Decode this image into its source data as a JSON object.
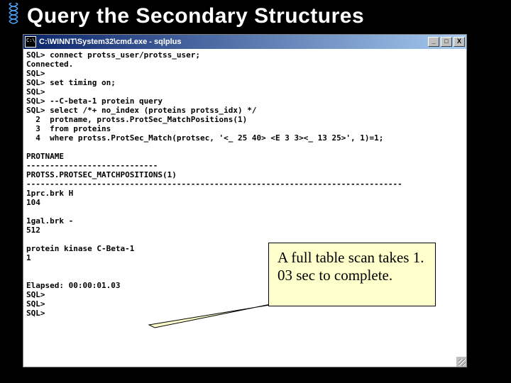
{
  "slide": {
    "title": "Query the Secondary Structures"
  },
  "window": {
    "title": "C:\\WINNT\\System32\\cmd.exe - sqlplus",
    "buttons": {
      "min": "_",
      "max": "□",
      "close": "X"
    }
  },
  "terminal": {
    "text": "SQL> connect protss_user/protss_user;\nConnected.\nSQL>\nSQL> set timing on;\nSQL>\nSQL> --C-beta-1 protein query\nSQL> select /*+ no_index (proteins protss_idx) */\n  2  protname, protss.ProtSec_MatchPositions(1)\n  3  from proteins\n  4  where protss.ProtSec_Match(protsec, '<_ 25 40> <E 3 3><_ 13 25>', 1)=1;\n\nPROTNAME\n----------------------------\nPROTSS.PROTSEC_MATCHPOSITIONS(1)\n--------------------------------------------------------------------------------\n1prc.brk H\n104\n\n1gal.brk -\n512\n\nprotein kinase C-Beta-1\n1\n\n\nElapsed: 00:00:01.03\nSQL>\nSQL>\nSQL>"
  },
  "callout": {
    "text": "A full table scan takes 1. 03 sec to complete."
  }
}
